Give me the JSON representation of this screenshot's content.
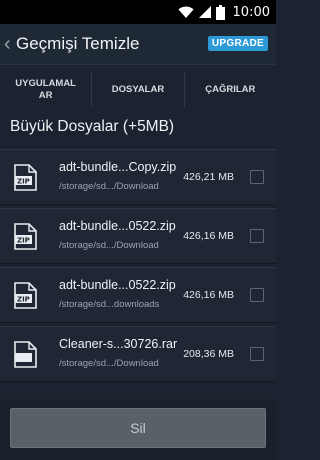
{
  "status_bar": {
    "time": "10:00"
  },
  "action_bar": {
    "title": "Geçmişi Temizle",
    "upgrade_label": "UPGRADE"
  },
  "tabs": [
    {
      "label": "UYGULAMALAR"
    },
    {
      "label": "DOSYALAR"
    },
    {
      "label": "ÇAĞRILAR"
    }
  ],
  "section_title": "Büyük Dosyalar (+5MB)",
  "files": [
    {
      "name": "adt-bundle...Copy.zip",
      "path": "/storage/sd.../Download",
      "size": "426,21 MB",
      "icon": "zip-icon",
      "checked": false
    },
    {
      "name": "adt-bundle...0522.zip",
      "path": "/storage/sd.../Download",
      "size": "426,16 MB",
      "icon": "zip-icon",
      "checked": false
    },
    {
      "name": "adt-bundle...0522.zip",
      "path": "/storage/sd...downloads",
      "size": "426,16 MB",
      "icon": "zip-icon",
      "checked": false
    },
    {
      "name": "Cleaner-s...30726.rar",
      "path": "/storage/sd.../Download",
      "size": "208,36 MB",
      "icon": "archive-icon",
      "checked": false
    }
  ],
  "delete_button_label": "Sil",
  "colors": {
    "accent": "#2c9ad6",
    "background": "#1b2330",
    "row": "#1f2735"
  }
}
